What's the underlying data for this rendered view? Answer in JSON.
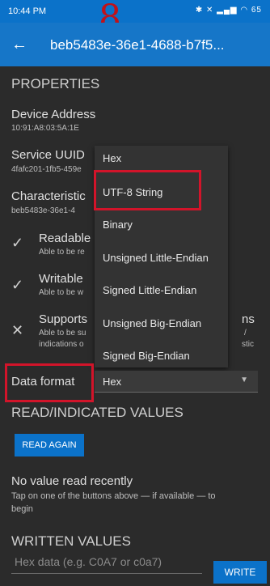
{
  "status": {
    "time": "10:44 PM",
    "battery": "65"
  },
  "annotation": "8.",
  "toolbar": {
    "title": "beb5483e-36e1-4688-b7f5..."
  },
  "properties": {
    "header": "PROPERTIES",
    "device_address_label": "Device Address",
    "device_address_value": "10:91:A8:03:5A:1E",
    "service_uuid_label": "Service UUID",
    "service_uuid_value": "4fafc201-1fb5-459e",
    "characteristic_label": "Characteristic",
    "characteristic_value": "beb5483e-36e1-4",
    "items": [
      {
        "title": "Readable",
        "subtitle": "Able to be re",
        "icon": "check"
      },
      {
        "title": "Writable",
        "subtitle": "Able to be w",
        "icon": "check"
      },
      {
        "title": "Supports",
        "subtitle_1": "Able to be su",
        "subtitle_2": "indications o",
        "title_tail": "ns",
        "sub_tail_1": "/",
        "sub_tail_2": "stic",
        "icon": "x"
      }
    ]
  },
  "data_format": {
    "label": "Data format",
    "selected": "Hex",
    "options": [
      "Hex",
      "UTF-8 String",
      "Binary",
      "Unsigned Little-Endian",
      "Signed Little-Endian",
      "Unsigned Big-Endian",
      "Signed Big-Endian"
    ]
  },
  "read_section": {
    "header": "READ/INDICATED VALUES",
    "button": "READ AGAIN",
    "no_value_title": "No value read recently",
    "no_value_help_1": "Tap on one of the buttons above — if available — to",
    "no_value_help_2": "begin"
  },
  "written_section": {
    "header": "WRITTEN VALUES",
    "input_placeholder": "Hex data (e.g. C0A7 or c0a7)",
    "button": "WRITE"
  },
  "colors": {
    "accent": "#1676c8",
    "highlight": "#d2142a",
    "background": "#2b2b2b"
  }
}
